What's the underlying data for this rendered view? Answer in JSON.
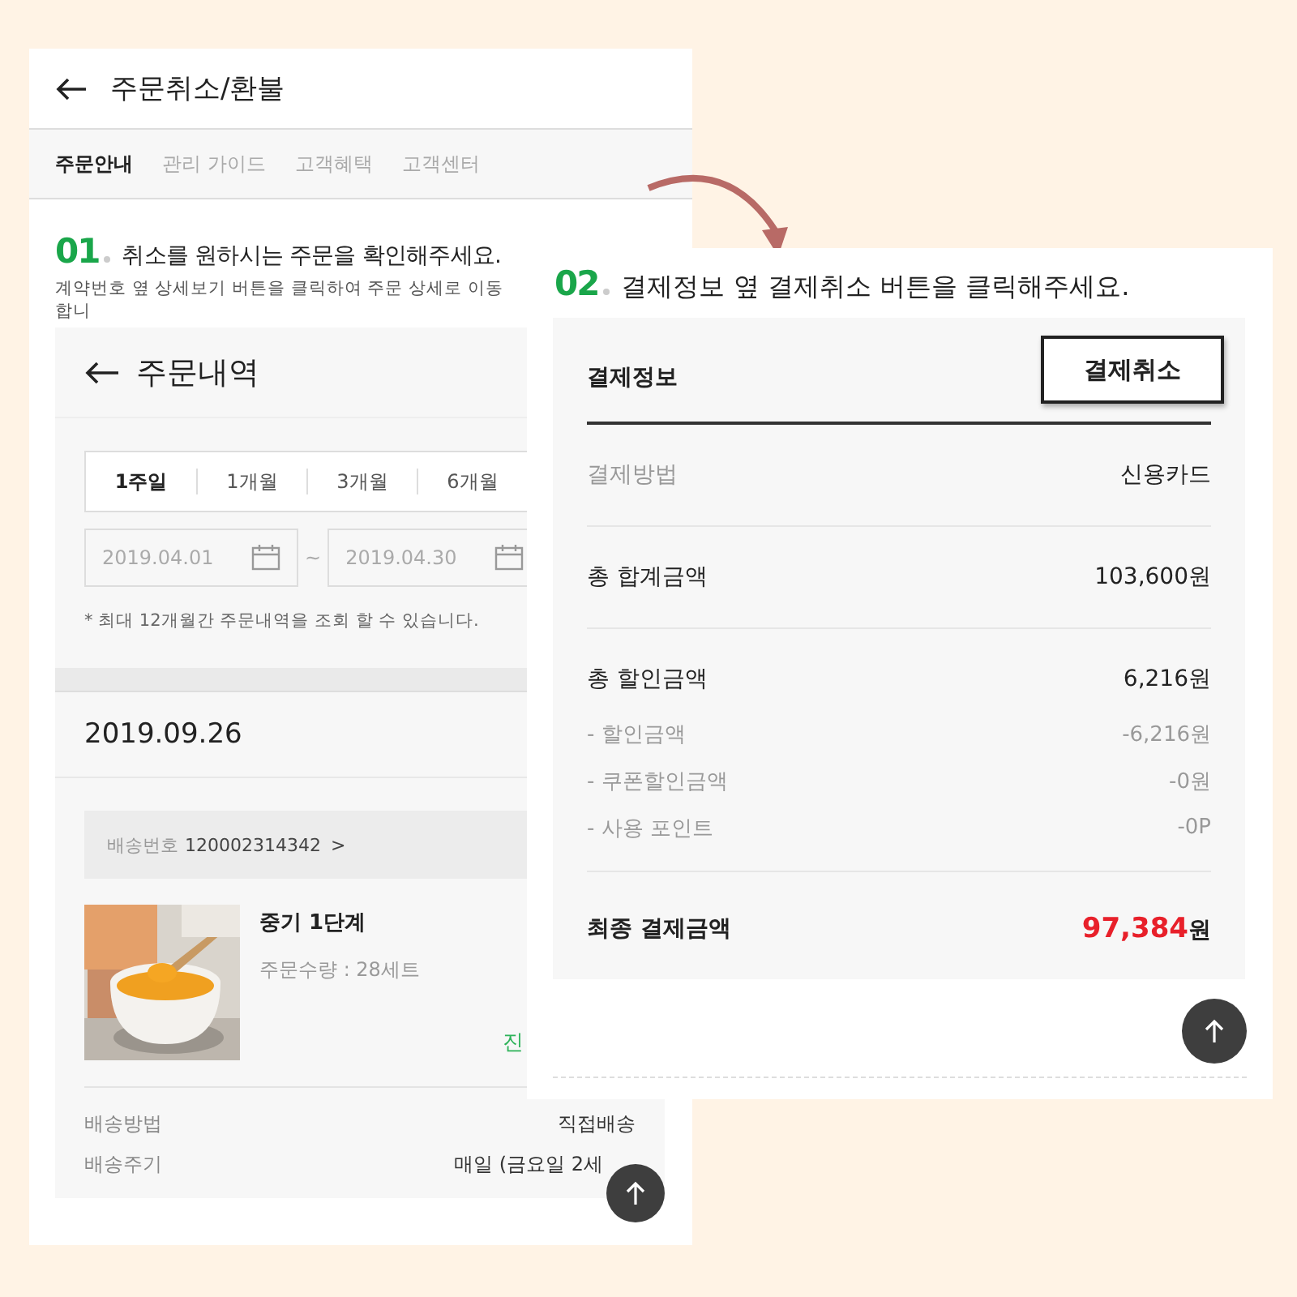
{
  "guide_page": {
    "title": "주문취소/환불",
    "tabs": [
      {
        "label": "주문안내",
        "selected": true
      },
      {
        "label": "관리 가이드",
        "selected": false
      },
      {
        "label": "고객혜택",
        "selected": false
      },
      {
        "label": "고객센터",
        "selected": false
      }
    ],
    "step": {
      "number": "01",
      "instruction": "취소를 원하시는 주문을 확인해주세요.",
      "note": "계약번호 옆 상세보기 버튼을 클릭하여 주문 상세로 이동합니"
    },
    "order_screen": {
      "title": "주문내역",
      "periods": [
        {
          "label": "1주일",
          "selected": true
        },
        {
          "label": "1개월",
          "selected": false
        },
        {
          "label": "3개월",
          "selected": false
        },
        {
          "label": "6개월",
          "selected": false
        }
      ],
      "date_from": "2019.04.01",
      "range_sep": "~",
      "date_to": "2019.04.30",
      "notice": "* 최대 12개월간 주문내역을 조회 할 수 있습니다.",
      "order_date": "2019.09.26",
      "shipment": {
        "label": "배송번호",
        "number": "120002314342",
        "chevron": ">"
      },
      "product": {
        "kind": "picture",
        "name": "중기 1단계",
        "quantity": "주문수량 : 28세트",
        "status": "진"
      },
      "details": [
        {
          "label": "배송방법",
          "value": "직접배송"
        },
        {
          "label": "배송주기",
          "value": "매일 (금요일 2세"
        }
      ]
    }
  },
  "payment_page": {
    "step": {
      "number": "02",
      "instruction": "결제정보 옆 결제취소 버튼을 클릭해주세요."
    },
    "section_title": "결제정보",
    "cancel_button": "결제취소",
    "rows": [
      {
        "kind": "muted",
        "label": "결제방법",
        "value": "신용카드"
      },
      {
        "kind": "main",
        "label": "총 합계금액",
        "value": "103,600원"
      },
      {
        "kind": "main",
        "label": "총 할인금액",
        "value": "6,216원"
      },
      {
        "kind": "sub",
        "label": "- 할인금액",
        "value": "-6,216원"
      },
      {
        "kind": "sub",
        "label": "- 쿠폰할인금액",
        "value": "-0원"
      },
      {
        "kind": "sub",
        "label": "- 사용 포인트",
        "value": "-0P"
      },
      {
        "kind": "total",
        "label": "최종 결제금액",
        "amount": "97,384",
        "unit": "원"
      }
    ]
  }
}
